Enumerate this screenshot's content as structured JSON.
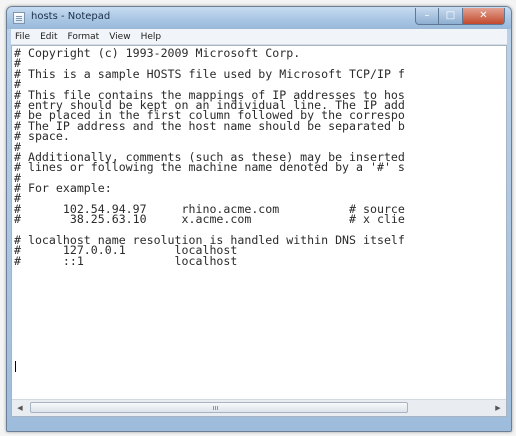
{
  "window": {
    "title": "hosts - Notepad"
  },
  "menu": {
    "items": [
      "File",
      "Edit",
      "Format",
      "View",
      "Help"
    ]
  },
  "document": {
    "lines": [
      "# Copyright (c) 1993-2009 Microsoft Corp.",
      "#",
      "# This is a sample HOSTS file used by Microsoft TCP/IP f",
      "#",
      "# This file contains the mappings of IP addresses to hos",
      "# entry should be kept on an individual line. The IP add",
      "# be placed in the first column followed by the correspo",
      "# The IP address and the host name should be separated b",
      "# space.",
      "#",
      "# Additionally, comments (such as these) may be inserted",
      "# lines or following the machine name denoted by a '#' s",
      "#",
      "# For example:",
      "#",
      "#      102.54.94.97     rhino.acme.com          # source",
      "#       38.25.63.10     x.acme.com              # x clie",
      "",
      "# localhost name resolution is handled within DNS itself",
      "#      127.0.0.1       localhost",
      "#      ::1             localhost",
      ""
    ]
  },
  "icons": {
    "app": "notepad-icon",
    "minimize": "minimize-icon",
    "maximize": "maximize-icon",
    "close": "close-icon",
    "scroll_left": "scroll-left-arrow-icon",
    "scroll_right": "scroll-right-arrow-icon"
  }
}
